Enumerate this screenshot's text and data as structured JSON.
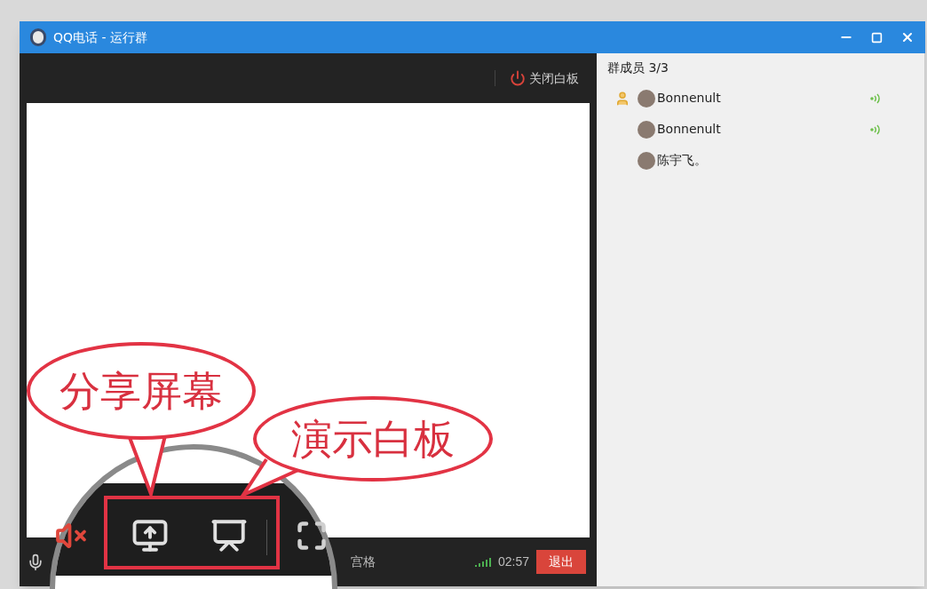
{
  "window": {
    "title": "QQ电话 - 运行群"
  },
  "toolbar": {
    "close_whiteboard": "关闭白板"
  },
  "members": {
    "heading": "群成员 3/3",
    "items": [
      {
        "name": "Bonnenult",
        "host": true,
        "speaking": true
      },
      {
        "name": "Bonnenult",
        "host": false,
        "speaking": true
      },
      {
        "name": "陈宇飞。",
        "host": false,
        "speaking": false
      }
    ]
  },
  "bottom_bar": {
    "speaker_muted": true,
    "layout_label": "宫格",
    "duration": "02:57",
    "exit": "退出"
  },
  "annotations": [
    {
      "text": "分享屏幕"
    },
    {
      "text": "演示白板"
    }
  ]
}
